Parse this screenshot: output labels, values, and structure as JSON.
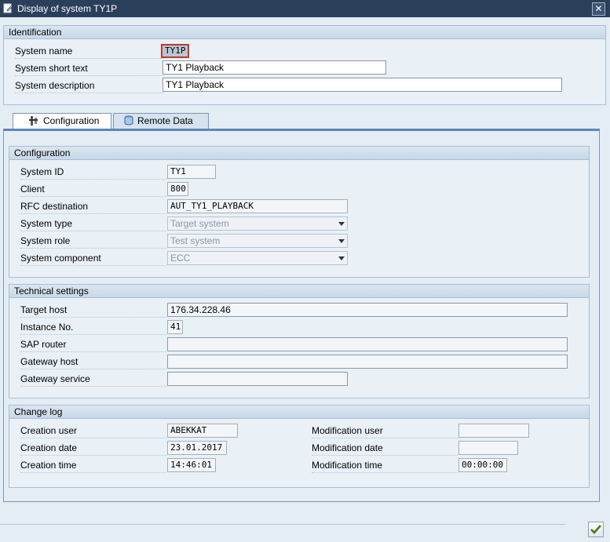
{
  "window": {
    "title": "Display of system TY1P",
    "close_label": "✕"
  },
  "identification": {
    "header": "Identification",
    "system_name_label": "System name",
    "system_name_value": "TY1P",
    "short_text_label": "System short text",
    "short_text_value": "TY1 Playback",
    "description_label": "System description",
    "description_value": "TY1 Playback"
  },
  "tabs": [
    {
      "label": "Configuration",
      "active": true
    },
    {
      "label": "Remote Data",
      "active": false
    }
  ],
  "configuration": {
    "header": "Configuration",
    "system_id_label": "System ID",
    "system_id_value": "TY1",
    "client_label": "Client",
    "client_value": "800",
    "rfc_label": "RFC destination",
    "rfc_value": "AUT_TY1_PLAYBACK",
    "system_type_label": "System type",
    "system_type_value": "Target system",
    "system_role_label": "System role",
    "system_role_value": "Test system",
    "system_component_label": "System component",
    "system_component_value": "ECC"
  },
  "technical": {
    "header": "Technical settings",
    "target_host_label": "Target host",
    "target_host_value": "176.34.228.46",
    "instance_label": "Instance No.",
    "instance_value": "41",
    "sap_router_label": "SAP router",
    "sap_router_value": "",
    "gateway_host_label": "Gateway host",
    "gateway_host_value": "",
    "gateway_service_label": "Gateway service",
    "gateway_service_value": ""
  },
  "changelog": {
    "header": "Change log",
    "creation_user_label": "Creation user",
    "creation_user_value": "ABEKKAT",
    "creation_date_label": "Creation date",
    "creation_date_value": "23.01.2017",
    "creation_time_label": "Creation time",
    "creation_time_value": "14:46:01",
    "mod_user_label": "Modification user",
    "mod_user_value": "",
    "mod_date_label": "Modification date",
    "mod_date_value": "",
    "mod_time_label": "Modification time",
    "mod_time_value": "00:00:00"
  },
  "colors": {
    "titlebar": "#2a3f5a",
    "accent": "#5d86b6",
    "focus_border": "#c0392b",
    "ok_check": "#4a7a10"
  }
}
